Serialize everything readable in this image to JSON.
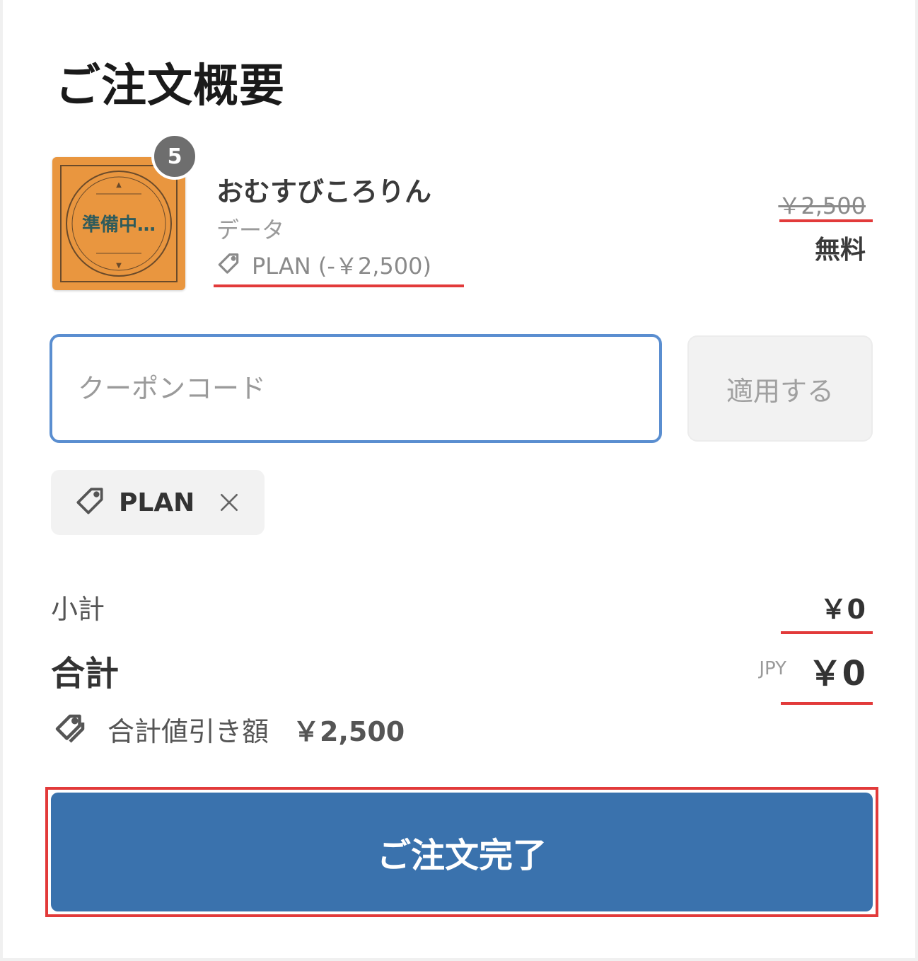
{
  "summary": {
    "title": "ご注文概要"
  },
  "product": {
    "quantity": "5",
    "name": "おむすびころりん",
    "variant": "データ",
    "discount_text": "PLAN (-￥2,500)",
    "original_price": "￥2,500",
    "final_price": "無料",
    "thumbnail_text": "準備中…"
  },
  "coupon": {
    "placeholder": "クーポンコード",
    "value": "",
    "apply_label": "適用する"
  },
  "applied_code": {
    "label": "PLAN"
  },
  "totals": {
    "subtotal_label": "小計",
    "subtotal_value": "￥0",
    "total_label": "合計",
    "currency": "JPY",
    "total_value": "￥0",
    "discount_label": "合計値引き額",
    "discount_value": "￥2,500"
  },
  "actions": {
    "complete_label": "ご注文完了"
  },
  "colors": {
    "primary": "#3a72ad",
    "highlight": "#e23a3a",
    "focus_border": "#5a8ed0",
    "thumbnail_bg": "#e9963f"
  }
}
